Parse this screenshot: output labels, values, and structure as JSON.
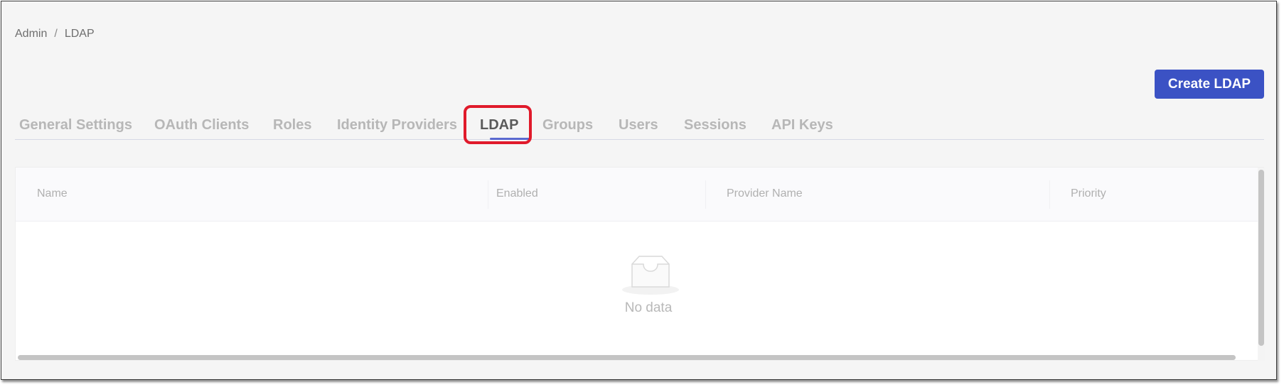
{
  "breadcrumb": {
    "items": [
      "Admin",
      "LDAP"
    ],
    "separator": "/"
  },
  "toolbar": {
    "create_label": "Create LDAP"
  },
  "tabs": [
    {
      "label": "General Settings"
    },
    {
      "label": "OAuth Clients"
    },
    {
      "label": "Roles"
    },
    {
      "label": "Identity Providers"
    },
    {
      "label": "LDAP",
      "active": true
    },
    {
      "label": "Groups"
    },
    {
      "label": "Users"
    },
    {
      "label": "Sessions"
    },
    {
      "label": "API Keys"
    }
  ],
  "table": {
    "columns": [
      "Name",
      "Enabled",
      "Provider Name",
      "Priority"
    ],
    "rows": [],
    "empty_text": "No data"
  },
  "colors": {
    "accent": "#3b52c4",
    "tab_underline": "#5b6ad0",
    "highlight": "#e01a2b"
  },
  "icons": {
    "empty": "inbox-icon"
  }
}
